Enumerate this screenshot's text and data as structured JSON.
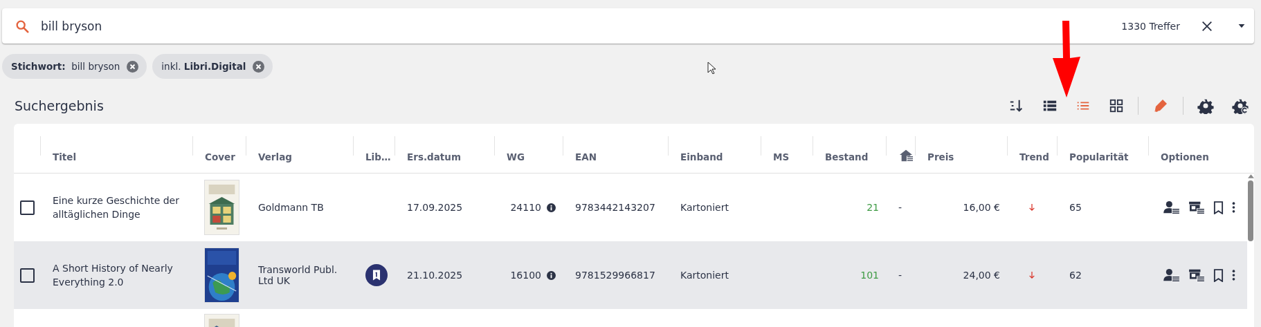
{
  "search": {
    "value": "bill bryson",
    "hits": "1330 Treffer"
  },
  "filters": [
    {
      "kind": "keyword",
      "label": "Stichwort:",
      "value": "bill bryson"
    },
    {
      "kind": "text",
      "text": "inkl. **Libri.Digital**"
    }
  ],
  "results": {
    "title": "Suchergebnis",
    "view_modes": [
      {
        "kind": "sort",
        "selected": false
      },
      {
        "kind": "table",
        "selected": false
      },
      {
        "kind": "list",
        "selected": true
      },
      {
        "kind": "grid",
        "selected": false
      }
    ],
    "actions": [
      {
        "kind": "highlight"
      },
      {
        "kind": "settings"
      },
      {
        "kind": "settings-reset"
      }
    ]
  },
  "table": {
    "columns": [
      {
        "kind": "text",
        "label": "Titel"
      },
      {
        "kind": "text",
        "label": "Cover"
      },
      {
        "kind": "text",
        "label": "Verlag"
      },
      {
        "kind": "text",
        "label": "Lib…"
      },
      {
        "kind": "text",
        "label": "Ers.datum"
      },
      {
        "kind": "text",
        "label": "WG"
      },
      {
        "kind": "text",
        "label": "EAN"
      },
      {
        "kind": "text",
        "label": "Einband"
      },
      {
        "kind": "text",
        "label": "MS"
      },
      {
        "kind": "text",
        "label": "Bestand"
      },
      {
        "kind": "icon"
      },
      {
        "kind": "text",
        "label": "Preis"
      },
      {
        "kind": "text",
        "label": "Trend"
      },
      {
        "kind": "text",
        "label": "Popularität"
      },
      {
        "kind": "text",
        "label": "Optionen"
      }
    ],
    "rows": [
      {
        "checked": false,
        "highlighted": false,
        "title": "Eine kurze Geschichte der alltäglichen Dinge",
        "publisher": "Goldmann TB",
        "lib_badge": false,
        "date": "17.09.2025",
        "wg": "24110",
        "ean": "9783442143207",
        "binding": "Kartoniert",
        "stock": "21",
        "store_stock": "-",
        "price": "16,00 €",
        "trend": {
          "kind": "down"
        },
        "popularity": "65"
      },
      {
        "checked": false,
        "highlighted": true,
        "title": "A Short History of Nearly Everything 2.0",
        "publisher": "Transworld Publ. Ltd UK",
        "lib_badge": true,
        "date": "21.10.2025",
        "wg": "16100",
        "ean": "9781529966817",
        "binding": "Kartoniert",
        "stock": "101",
        "store_stock": "-",
        "price": "24,00 €",
        "trend": {
          "kind": "down"
        },
        "popularity": "62"
      }
    ]
  }
}
